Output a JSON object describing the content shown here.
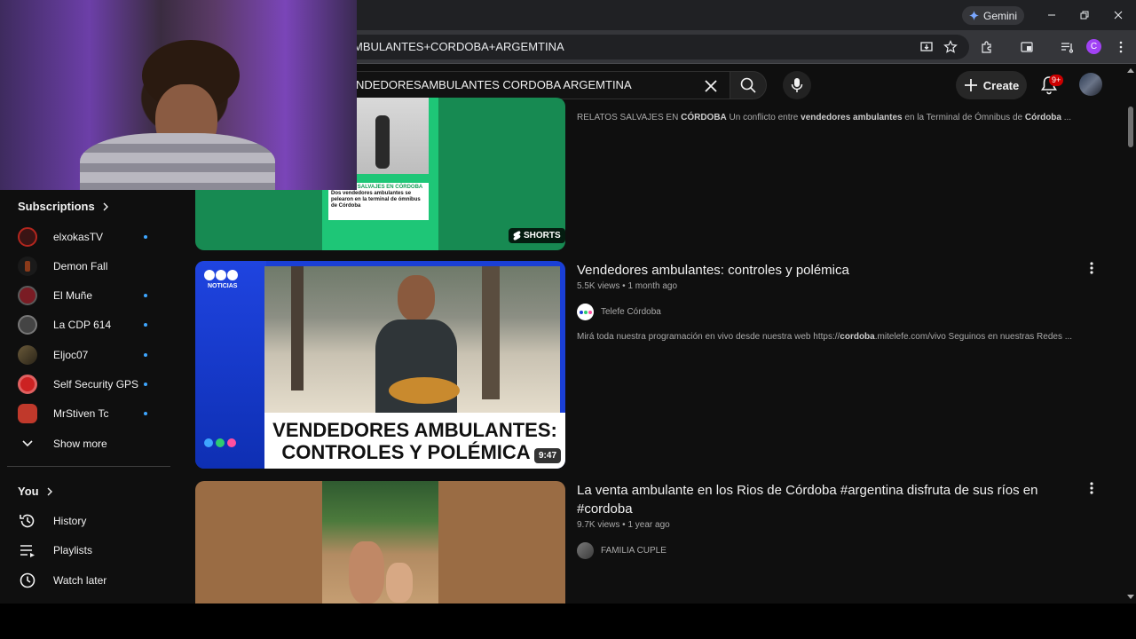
{
  "browser": {
    "gemini_label": "Gemini",
    "url": "VENDEDORESAMBULANTES+CORDOBA+ARGEMTINA",
    "url_visible": "MBULANTES+CORDOBA+ARGEMTINA",
    "profile_letter": "C"
  },
  "header": {
    "search_value": "NDEDORESAMBULANTES CORDOBA ARGEMTINA",
    "create_label": "Create",
    "notifications_badge": "9+"
  },
  "sidebar": {
    "subscriptions_title": "Subscriptions",
    "subscriptions": [
      {
        "label": "elxokasTV",
        "new": true,
        "color": "#b3261e"
      },
      {
        "label": "Demon Fall",
        "new": false,
        "color": "#5a2a1a"
      },
      {
        "label": "El Muñe",
        "new": true,
        "color": "#7a1c24"
      },
      {
        "label": "La CDP 614",
        "new": true,
        "color": "#444444"
      },
      {
        "label": "Eljoc07",
        "new": true,
        "color": "#4a3a2a"
      },
      {
        "label": "Self Security GPS",
        "new": true,
        "color": "#cc2222"
      },
      {
        "label": "MrStiven Tc",
        "new": true,
        "color": "#c0392b"
      }
    ],
    "show_more_label": "Show more",
    "you_title": "You",
    "you_items": [
      {
        "label": "History",
        "icon": "history-icon"
      },
      {
        "label": "Playlists",
        "icon": "playlists-icon"
      },
      {
        "label": "Watch later",
        "icon": "watch-later-icon"
      }
    ]
  },
  "results": [
    {
      "type": "short",
      "thumb_card_title": "RELATOS SALVAJES EN CÓRDOBA",
      "thumb_card_text": "Dos vendedores ambulantes se pelearon en la terminal de ómnibus de Córdoba",
      "badge": "SHORTS",
      "desc_parts": [
        {
          "text": "RELATOS SALVAJES EN ",
          "bold": false
        },
        {
          "text": "CÓRDOBA",
          "bold": true
        },
        {
          "text": " Un conflicto entre ",
          "bold": false
        },
        {
          "text": "vendedores ambulantes",
          "bold": true
        },
        {
          "text": " en la Terminal de Ómnibus de ",
          "bold": false
        },
        {
          "text": "Córdoba",
          "bold": true
        },
        {
          "text": " ...",
          "bold": false
        }
      ]
    },
    {
      "type": "video",
      "title": "Vendedores ambulantes: controles y polémica",
      "views": "5.5K views",
      "age": "1 month ago",
      "channel": "Telefe Córdoba",
      "thumb_brand": "NOTICIAS",
      "thumb_caption_1": "VENDEDORES AMBULANTES:",
      "thumb_caption_2": "CONTROLES Y POLÉMICA",
      "duration": "9:47",
      "desc_parts": [
        {
          "text": "Mirá toda nuestra programación en vivo desde nuestra web https://",
          "bold": false
        },
        {
          "text": "cordoba",
          "bold": true
        },
        {
          "text": ".mitelefe.com/vivo Seguinos en nuestras Redes ...",
          "bold": false
        }
      ]
    },
    {
      "type": "video",
      "title": "La venta ambulante en los Rios de Córdoba #argentina disfruta de sus ríos en #cordoba",
      "views": "9.7K views",
      "age": "1 year ago",
      "channel": "FAMILIA CUPLE"
    }
  ],
  "meta_separator": "•",
  "colors": {
    "background": "#0f0f0f",
    "accent_blue": "#3ea6ff",
    "notification_red": "#cc0000",
    "shorts_green": "#1ec677"
  }
}
